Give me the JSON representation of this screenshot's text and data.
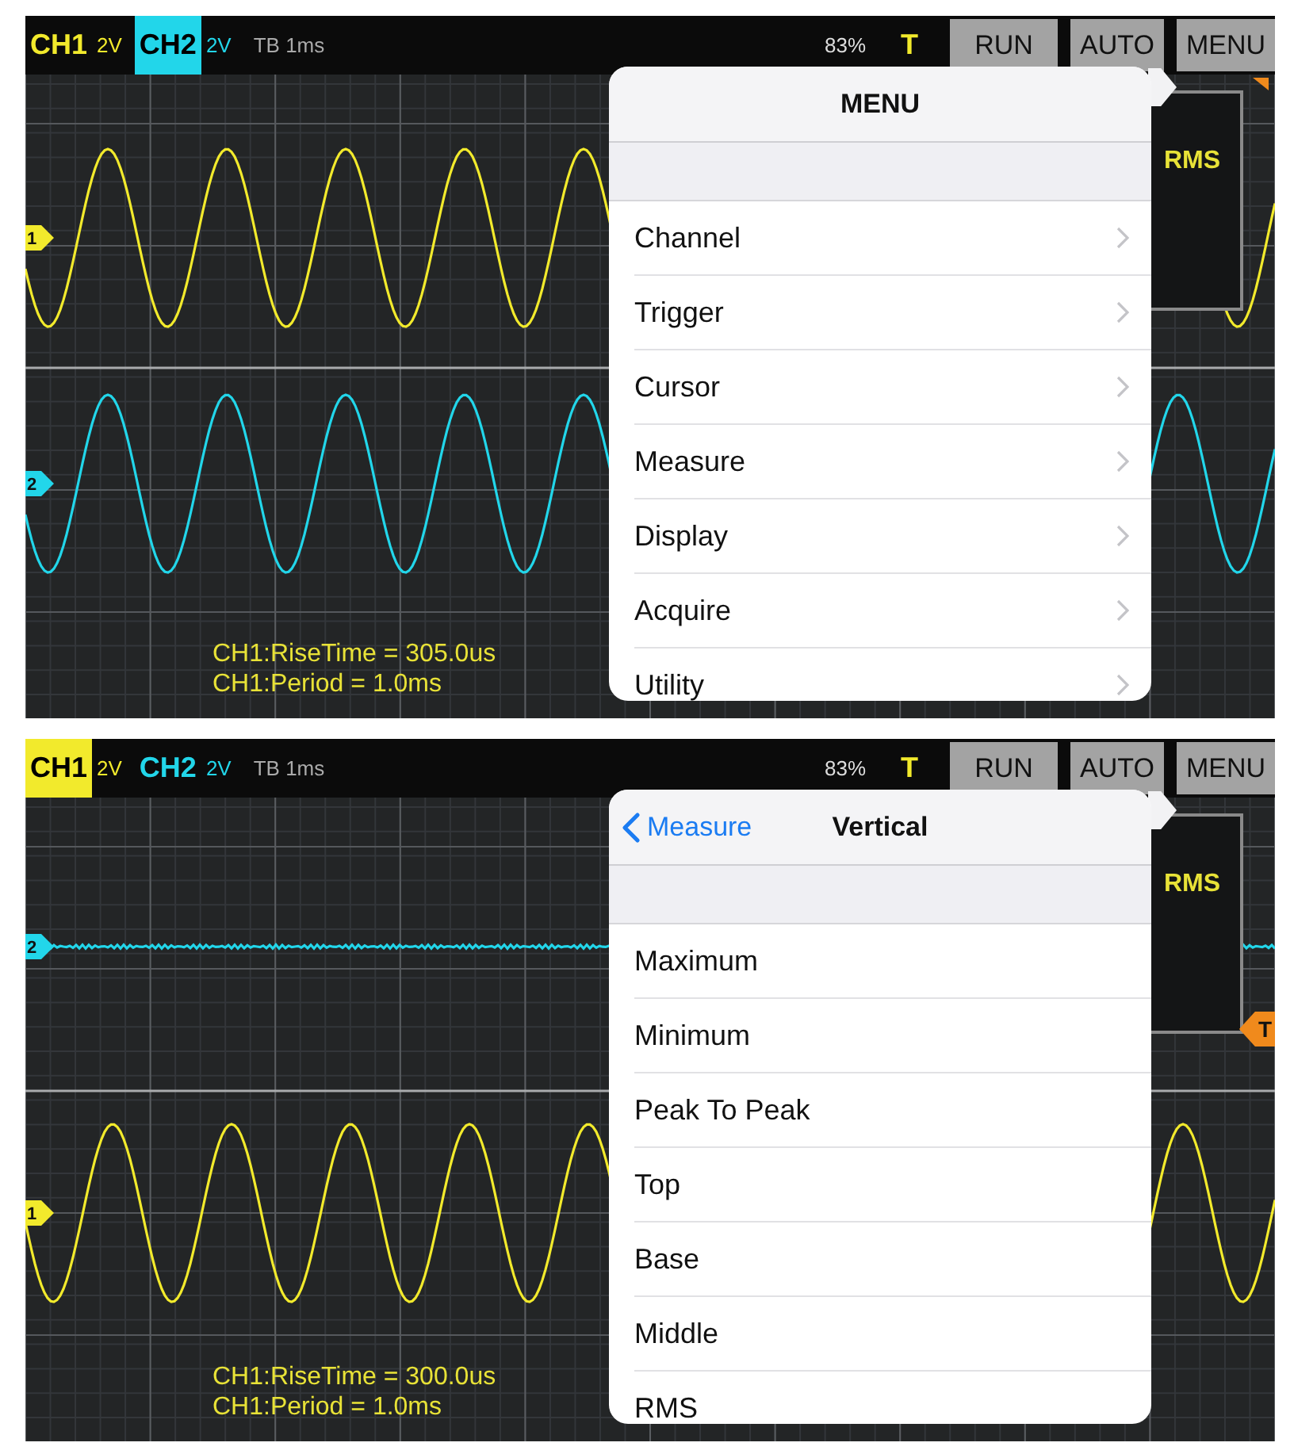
{
  "panels": [
    {
      "header": {
        "channels": [
          {
            "label": "CH1",
            "volts": "2V",
            "color": "#f2ea2c",
            "selected": false
          },
          {
            "label": "CH2",
            "volts": "2V",
            "color": "#22d6ea",
            "selected": true
          }
        ],
        "timebase": "TB 1ms",
        "battery": "83%",
        "trigger": "T",
        "buttons": [
          "RUN",
          "AUTO",
          "MENU"
        ]
      },
      "traces": [
        {
          "marker": "1",
          "color": "#f2ea2c",
          "kind": "sine"
        },
        {
          "marker": "2",
          "color": "#22d6ea",
          "kind": "sine"
        }
      ],
      "measurements": [
        "CH1:RiseTime = 305.0us",
        "CH1:Period = 1.0ms"
      ],
      "rms_box": {
        "label": "RMS"
      },
      "popover": {
        "title": "MENU",
        "items": [
          {
            "label": "Channel",
            "kind": "submenu"
          },
          {
            "label": "Trigger",
            "kind": "submenu"
          },
          {
            "label": "Cursor",
            "kind": "submenu"
          },
          {
            "label": "Measure",
            "kind": "submenu"
          },
          {
            "label": "Display",
            "kind": "submenu"
          },
          {
            "label": "Acquire",
            "kind": "submenu"
          },
          {
            "label": "Utility",
            "kind": "submenu"
          }
        ]
      }
    },
    {
      "header": {
        "channels": [
          {
            "label": "CH1",
            "volts": "2V",
            "color": "#f2ea2c",
            "selected": true
          },
          {
            "label": "CH2",
            "volts": "2V",
            "color": "#22d6ea",
            "selected": false
          }
        ],
        "timebase": "TB 1ms",
        "battery": "83%",
        "trigger": "T",
        "buttons": [
          "RUN",
          "AUTO",
          "MENU"
        ]
      },
      "traces": [
        {
          "marker": "2",
          "color": "#22d6ea",
          "kind": "flat"
        },
        {
          "marker": "1",
          "color": "#f2ea2c",
          "kind": "sine"
        }
      ],
      "measurements": [
        "CH1:RiseTime = 300.0us",
        "CH1:Period = 1.0ms"
      ],
      "rms_box": {
        "label": "RMS"
      },
      "trigger_marker": "T",
      "popover": {
        "back": "Measure",
        "title": "Vertical",
        "items": [
          {
            "label": "Maximum",
            "kind": "option"
          },
          {
            "label": "Minimum",
            "kind": "option"
          },
          {
            "label": "Peak To Peak",
            "kind": "option"
          },
          {
            "label": "Top",
            "kind": "option"
          },
          {
            "label": "Base",
            "kind": "option"
          },
          {
            "label": "Middle",
            "kind": "option"
          },
          {
            "label": "RMS",
            "kind": "option"
          }
        ]
      }
    }
  ]
}
